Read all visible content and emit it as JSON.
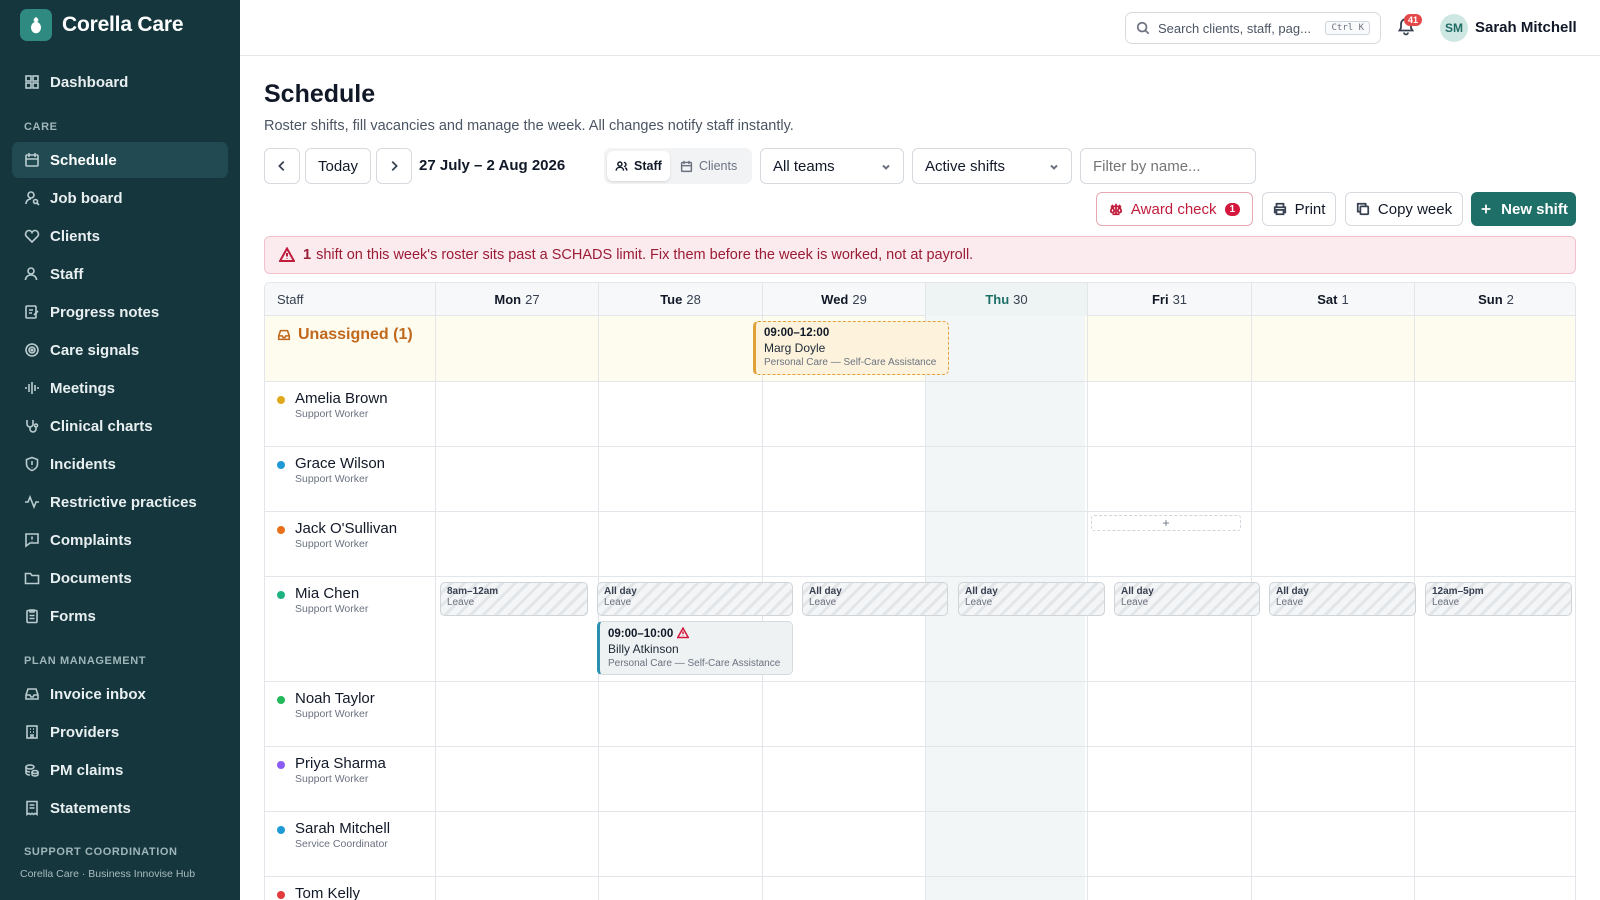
{
  "brand": {
    "name": "Corella Care"
  },
  "sidebar": {
    "items": [
      {
        "label": "Dashboard",
        "icon": "grid-icon"
      },
      {
        "label": "Schedule",
        "icon": "calendar-icon",
        "active": true
      },
      {
        "label": "Job board",
        "icon": "user-search-icon"
      },
      {
        "label": "Clients",
        "icon": "heart-icon"
      },
      {
        "label": "Staff",
        "icon": "users-icon"
      },
      {
        "label": "Progress notes",
        "icon": "note-icon"
      },
      {
        "label": "Care signals",
        "icon": "signal-icon"
      },
      {
        "label": "Meetings",
        "icon": "waveform-icon"
      },
      {
        "label": "Clinical charts",
        "icon": "stethoscope-icon"
      },
      {
        "label": "Incidents",
        "icon": "shield-icon"
      },
      {
        "label": "Restrictive practices",
        "icon": "activity-icon"
      },
      {
        "label": "Complaints",
        "icon": "message-alert-icon"
      },
      {
        "label": "Documents",
        "icon": "folder-icon"
      },
      {
        "label": "Forms",
        "icon": "clipboard-icon"
      },
      {
        "label": "Invoice inbox",
        "icon": "inbox-icon"
      },
      {
        "label": "Providers",
        "icon": "building-icon"
      },
      {
        "label": "PM claims",
        "icon": "coins-icon"
      },
      {
        "label": "Statements",
        "icon": "receipt-icon"
      }
    ],
    "sections": {
      "care": "CARE",
      "plan": "PLAN MANAGEMENT",
      "support": "SUPPORT COORDINATION"
    },
    "footer": "Corella Care · Business Innovise Hub"
  },
  "topbar": {
    "search_placeholder": "Search clients, staff, pag...",
    "shortcut": "Ctrl K",
    "notifications": "41",
    "user_initials": "SM",
    "user_name": "Sarah Mitchell"
  },
  "page": {
    "title": "Schedule",
    "subtitle": "Roster shifts, fill vacancies and manage the week. All changes notify staff instantly."
  },
  "toolbar": {
    "today": "Today",
    "date_range": "27 July – 2 Aug 2026",
    "view_staff": "Staff",
    "view_clients": "Clients",
    "teams": "All teams",
    "shift_filter": "Active shifts",
    "filter_placeholder": "Filter by name...",
    "award_check": "Award check",
    "award_count": "1",
    "print": "Print",
    "copy_week": "Copy week",
    "new_shift": "New shift"
  },
  "alert": {
    "count": "1",
    "text": "shift on this week's roster sits past a SCHADS limit. Fix them before the week is worked, not at payroll."
  },
  "grid": {
    "staff_header": "Staff",
    "days": [
      {
        "day": "Mon",
        "date": "27"
      },
      {
        "day": "Tue",
        "date": "28"
      },
      {
        "day": "Wed",
        "date": "29"
      },
      {
        "day": "Thu",
        "date": "30",
        "today": true
      },
      {
        "day": "Fri",
        "date": "31"
      },
      {
        "day": "Sat",
        "date": "1"
      },
      {
        "day": "Sun",
        "date": "2"
      }
    ],
    "unassigned_label": "Unassigned (1)",
    "open_shift": {
      "time": "09:00–12:00",
      "client": "Marg Doyle",
      "service": "Personal Care — Self-Care Assistance"
    },
    "staff": [
      {
        "name": "Amelia Brown",
        "role": "Support Worker",
        "color": "#e0a91c"
      },
      {
        "name": "Grace Wilson",
        "role": "Support Worker",
        "color": "#1f9ad6"
      },
      {
        "name": "Jack O'Sullivan",
        "role": "Support Worker",
        "color": "#e8701c"
      },
      {
        "name": "Mia Chen",
        "role": "Support Worker",
        "color": "#1db382"
      },
      {
        "name": "Noah Taylor",
        "role": "Support Worker",
        "color": "#22b85c"
      },
      {
        "name": "Priya Sharma",
        "role": "Support Worker",
        "color": "#8b5cf6"
      },
      {
        "name": "Sarah Mitchell",
        "role": "Service Coordinator",
        "color": "#1f9ad6"
      },
      {
        "name": "Tom Kelly",
        "role": "",
        "color": "#e23b3b"
      }
    ],
    "add_slot": "+",
    "mia_leave": [
      {
        "time": "8am–12am",
        "label": "Leave"
      },
      {
        "time": "All day",
        "label": "Leave"
      },
      {
        "time": "All day",
        "label": "Leave"
      },
      {
        "time": "All day",
        "label": "Leave"
      },
      {
        "time": "All day",
        "label": "Leave"
      },
      {
        "time": "All day",
        "label": "Leave"
      },
      {
        "time": "12am–5pm",
        "label": "Leave"
      }
    ],
    "mia_shift": {
      "time": "09:00–10:00",
      "client": "Billy Atkinson",
      "service": "Personal Care — Self-Care Assistance"
    }
  }
}
